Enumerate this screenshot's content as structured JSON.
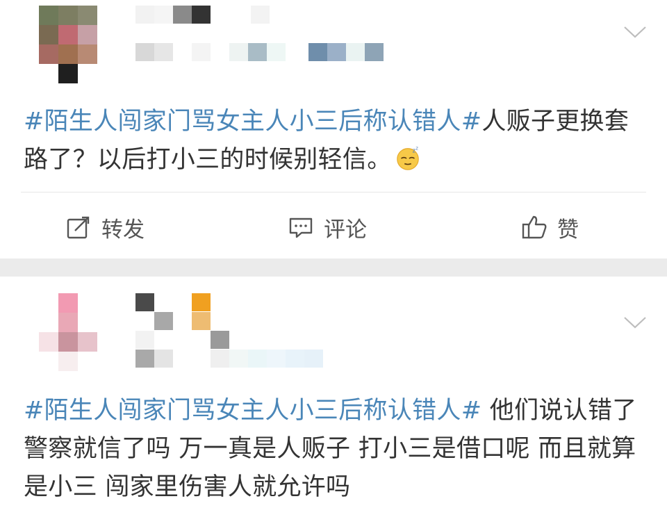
{
  "posts": [
    {
      "topic": "#陌生人闯家门骂女主人小三后称认错人#",
      "text": "人贩子更换套路了？以后打小三的时候别轻信。",
      "emoji": "sleepy-face",
      "actions": {
        "repost": "转发",
        "comment": "评论",
        "like": "赞"
      }
    },
    {
      "topic": "#陌生人闯家门骂女主人小三后称认错人#",
      "text": " 他们说认错了警察就信了吗 万一真是人贩子 打小三是借口呢 而且就算是小三 闯家里伤害人就允许吗"
    }
  ],
  "colors": {
    "topic": "#4a86b8",
    "text": "#333333",
    "separator": "#ebebeb"
  },
  "icons": [
    "repost-icon",
    "comment-icon",
    "like-icon",
    "chevron-down-icon"
  ]
}
